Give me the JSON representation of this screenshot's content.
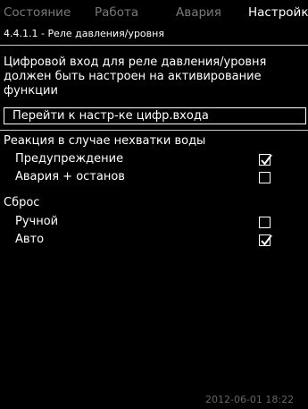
{
  "tabs": [
    {
      "label": "Состояние",
      "active": false
    },
    {
      "label": "Работа",
      "active": false
    },
    {
      "label": "Авария",
      "active": false
    },
    {
      "label": "Настройки",
      "active": true
    }
  ],
  "breadcrumb": "4.4.1.1 - Реле давления/уровня",
  "info_lines": [
    "Цифровой вход для реле давления/уровня",
    "должен быть настроен на активирование",
    "функции"
  ],
  "link_label": "Перейти к настр-ке цифр.входа",
  "sections": [
    {
      "heading": "Реакция в случае нехватки воды",
      "options": [
        {
          "label": "Предупреждение",
          "checked": true
        },
        {
          "label": "Авария + останов",
          "checked": false
        }
      ]
    },
    {
      "heading": "Сброс",
      "options": [
        {
          "label": "Ручной",
          "checked": false
        },
        {
          "label": "Авто",
          "checked": true
        }
      ]
    }
  ],
  "datetime": "2012-06-01 18:22",
  "colors": {
    "background": "#000000",
    "text": "#ffffff",
    "dim_text": "#7a7a7a"
  }
}
